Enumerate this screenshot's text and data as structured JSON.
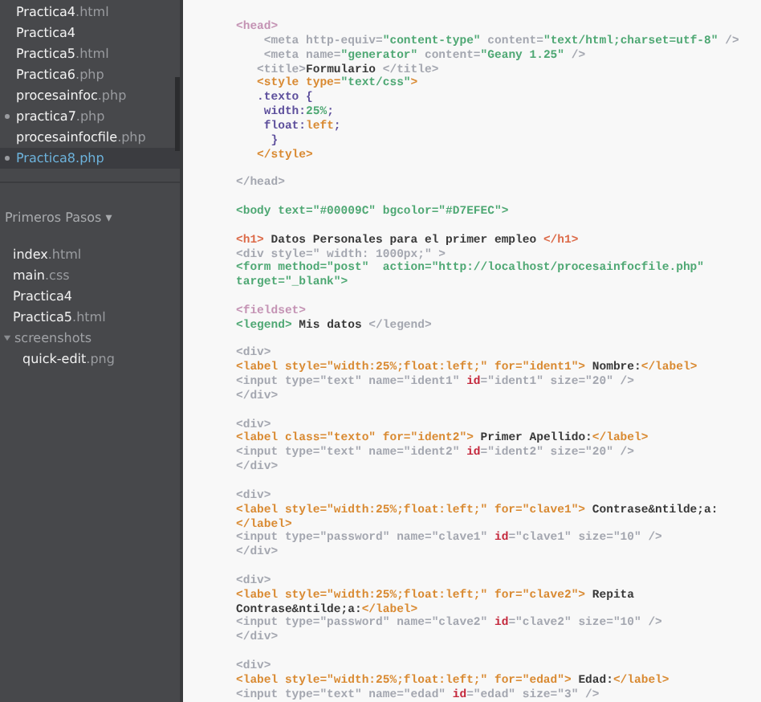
{
  "working_files": [
    {
      "name": "Practica4",
      "ext": ".html",
      "selected": false,
      "modified": false
    },
    {
      "name": "Practica4",
      "selected": false,
      "modified": false
    },
    {
      "name": "Practica5",
      "ext": ".html",
      "selected": false,
      "modified": false
    },
    {
      "name": "Practica6",
      "ext": ".php",
      "selected": false,
      "modified": false
    },
    {
      "name": "procesainfoc",
      "ext": ".php",
      "selected": false,
      "modified": false
    },
    {
      "name": "practica7",
      "ext": ".php",
      "selected": false,
      "modified": true
    },
    {
      "name": "procesainfocfile",
      "ext": ".php",
      "selected": false,
      "modified": false
    },
    {
      "name": "Practica8",
      "ext": ".php",
      "selected": true,
      "modified": true
    }
  ],
  "project": {
    "title": "Primeros Pasos",
    "caret": "▾",
    "tree": [
      {
        "kind": "file",
        "name": "index",
        "ext": ".html"
      },
      {
        "kind": "file",
        "name": "main",
        "ext": ".css"
      },
      {
        "kind": "file",
        "name": "Practica4"
      },
      {
        "kind": "file",
        "name": "Practica5",
        "ext": ".html"
      },
      {
        "kind": "folder",
        "name": "screenshots",
        "expanded": true,
        "children": [
          {
            "kind": "file",
            "name": "quick-edit",
            "ext": ".png"
          }
        ]
      }
    ]
  },
  "code_lines": [
    {
      "tokens": [
        {
          "kind": "pink",
          "text": "<head>"
        }
      ]
    },
    {
      "tokens": [
        {
          "kind": "dim",
          "text": "    <meta http-equiv="
        },
        {
          "kind": "green",
          "text": "\"content-type\""
        },
        {
          "kind": "dim",
          "text": " content="
        },
        {
          "kind": "green",
          "text": "\"text/html;charset=utf-8\""
        },
        {
          "kind": "dim",
          "text": " />"
        }
      ]
    },
    {
      "tokens": [
        {
          "kind": "dim",
          "text": "    <meta name="
        },
        {
          "kind": "green",
          "text": "\"generator\""
        },
        {
          "kind": "dim",
          "text": " content="
        },
        {
          "kind": "green",
          "text": "\"Geany 1.25\""
        },
        {
          "kind": "dim",
          "text": " />"
        }
      ]
    },
    {
      "tokens": [
        {
          "kind": "dim",
          "text": "   <title>"
        },
        {
          "kind": "text",
          "text": "Formulario "
        },
        {
          "kind": "dim",
          "text": "</title>"
        }
      ]
    },
    {
      "tokens": [
        {
          "kind": "orange",
          "text": "   <style type="
        },
        {
          "kind": "green",
          "text": "\"text/css\""
        },
        {
          "kind": "orange",
          "text": ">"
        }
      ]
    },
    {
      "tokens": [
        {
          "kind": "purple",
          "text": "   .texto {"
        }
      ]
    },
    {
      "tokens": [
        {
          "kind": "purple",
          "text": "    width:"
        },
        {
          "kind": "green",
          "text": "25%"
        },
        {
          "kind": "purple",
          "text": ";"
        }
      ]
    },
    {
      "tokens": [
        {
          "kind": "purple",
          "text": "    float:"
        },
        {
          "kind": "orange",
          "text": "left"
        },
        {
          "kind": "purple",
          "text": ";"
        }
      ]
    },
    {
      "tokens": [
        {
          "kind": "purple",
          "text": "     }"
        }
      ]
    },
    {
      "tokens": [
        {
          "kind": "orange",
          "text": "   </style>"
        }
      ]
    },
    {
      "kind": "blank"
    },
    {
      "tokens": [
        {
          "kind": "dim",
          "text": "</head>"
        }
      ]
    },
    {
      "kind": "blank"
    },
    {
      "tokens": [
        {
          "kind": "green",
          "text": "<body text=\"#00009C\" bgcolor=\"#D7EFEC\">"
        }
      ]
    },
    {
      "kind": "blank"
    },
    {
      "tokens": [
        {
          "kind": "coral",
          "text": "<h1>"
        },
        {
          "kind": "text",
          "text": " Datos Personales para el primer empleo "
        },
        {
          "kind": "coral",
          "text": "</h1>"
        }
      ]
    },
    {
      "tokens": [
        {
          "kind": "dim",
          "text": "<div style=\" width: 1000px;\" >"
        }
      ]
    },
    {
      "tokens": [
        {
          "kind": "green",
          "text": "<form method=\"post\"  action=\"http://localhost/procesainfocfile.php\""
        }
      ]
    },
    {
      "tokens": [
        {
          "kind": "green",
          "text": "target=\"_blank\">"
        }
      ]
    },
    {
      "kind": "blank"
    },
    {
      "tokens": [
        {
          "kind": "pink",
          "text": "<fieldset>"
        }
      ]
    },
    {
      "tokens": [
        {
          "kind": "green",
          "text": "<legend>"
        },
        {
          "kind": "text",
          "text": " Mis datos "
        },
        {
          "kind": "dim",
          "text": "</legend>"
        }
      ]
    },
    {
      "kind": "blank"
    },
    {
      "tokens": [
        {
          "kind": "dim",
          "text": "<div>"
        }
      ]
    },
    {
      "tokens": [
        {
          "kind": "orange",
          "text": "<label style=\"width:25%;float:left;\" for=\"ident1\">"
        },
        {
          "kind": "text",
          "text": " Nombre:"
        },
        {
          "kind": "orange",
          "text": "</label>"
        }
      ]
    },
    {
      "tokens": [
        {
          "kind": "dim",
          "text": "<input type=\"text\" name=\"ident1\" "
        },
        {
          "kind": "red",
          "text": "id"
        },
        {
          "kind": "dim",
          "text": "=\"ident1\" size=\"20\" />"
        }
      ]
    },
    {
      "tokens": [
        {
          "kind": "dim",
          "text": "</div>"
        }
      ]
    },
    {
      "kind": "blank"
    },
    {
      "tokens": [
        {
          "kind": "dim",
          "text": "<div>"
        }
      ]
    },
    {
      "tokens": [
        {
          "kind": "orange",
          "text": "<label class=\"texto\" for=\"ident2\">"
        },
        {
          "kind": "text",
          "text": " Primer Apellido:"
        },
        {
          "kind": "orange",
          "text": "</label>"
        }
      ]
    },
    {
      "tokens": [
        {
          "kind": "dim",
          "text": "<input type=\"text\" name=\"ident2\" "
        },
        {
          "kind": "red",
          "text": "id"
        },
        {
          "kind": "dim",
          "text": "=\"ident2\" size=\"20\" />"
        }
      ]
    },
    {
      "tokens": [
        {
          "kind": "dim",
          "text": "</div>"
        }
      ]
    },
    {
      "kind": "blank"
    },
    {
      "tokens": [
        {
          "kind": "dim",
          "text": "<div>"
        }
      ]
    },
    {
      "tokens": [
        {
          "kind": "orange",
          "text": "<label style=\"width:25%;float:left;\" for=\"clave1\">"
        },
        {
          "kind": "text",
          "text": " Contrase&ntilde;a:"
        }
      ]
    },
    {
      "tokens": [
        {
          "kind": "orange",
          "text": "</label>"
        }
      ]
    },
    {
      "tokens": [
        {
          "kind": "dim",
          "text": "<input type=\"password\" name=\"clave1\" "
        },
        {
          "kind": "red",
          "text": "id"
        },
        {
          "kind": "dim",
          "text": "=\"clave1\" size=\"10\" />"
        }
      ]
    },
    {
      "tokens": [
        {
          "kind": "dim",
          "text": "</div>"
        }
      ]
    },
    {
      "kind": "blank"
    },
    {
      "tokens": [
        {
          "kind": "dim",
          "text": "<div>"
        }
      ]
    },
    {
      "tokens": [
        {
          "kind": "orange",
          "text": "<label style=\"width:25%;float:left;\" for=\"clave2\">"
        },
        {
          "kind": "text",
          "text": " Repita"
        }
      ]
    },
    {
      "tokens": [
        {
          "kind": "text",
          "text": "Contrase&ntilde;a:"
        },
        {
          "kind": "orange",
          "text": "</label>"
        }
      ]
    },
    {
      "tokens": [
        {
          "kind": "dim",
          "text": "<input type=\"password\" name=\"clave2\" "
        },
        {
          "kind": "red",
          "text": "id"
        },
        {
          "kind": "dim",
          "text": "=\"clave2\" size=\"10\" />"
        }
      ]
    },
    {
      "tokens": [
        {
          "kind": "dim",
          "text": "</div>"
        }
      ]
    },
    {
      "kind": "blank"
    },
    {
      "tokens": [
        {
          "kind": "dim",
          "text": "<div>"
        }
      ]
    },
    {
      "tokens": [
        {
          "kind": "orange",
          "text": "<label style=\"width:25%;float:left;\" for=\"edad\">"
        },
        {
          "kind": "text",
          "text": " Edad:"
        },
        {
          "kind": "orange",
          "text": "</label>"
        }
      ]
    },
    {
      "tokens": [
        {
          "kind": "dim",
          "text": "<input type=\"text\" name=\"edad\" "
        },
        {
          "kind": "red",
          "text": "id"
        },
        {
          "kind": "dim",
          "text": "=\"edad\" size=\"3\" />"
        }
      ]
    }
  ]
}
